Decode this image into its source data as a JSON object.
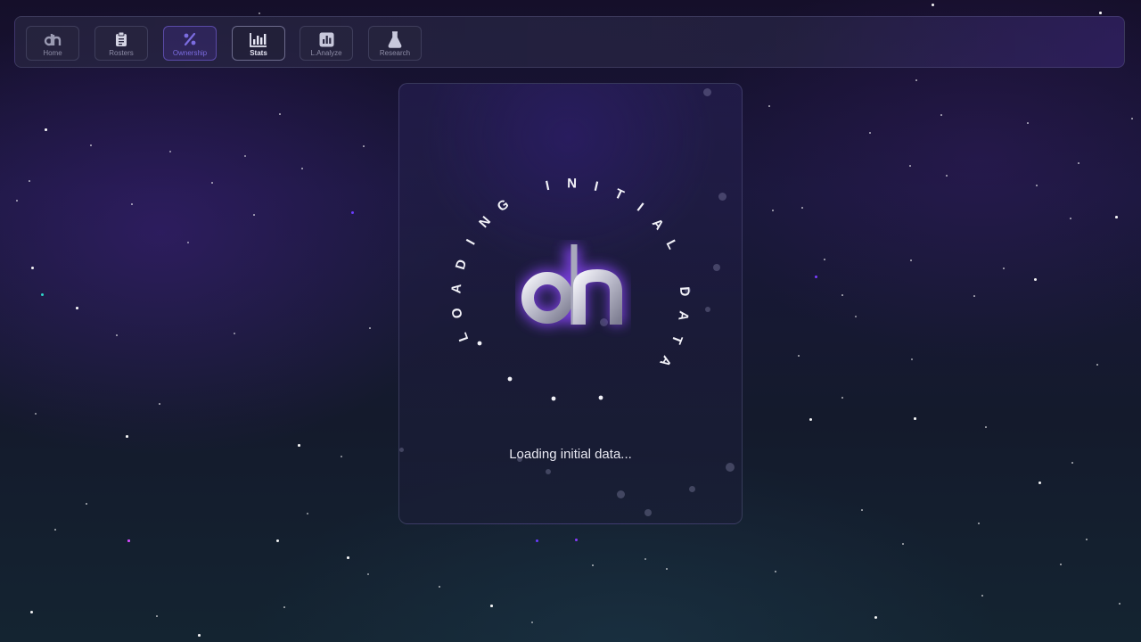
{
  "nav": {
    "items": [
      {
        "label": "Home",
        "icon": "dh-logo-icon"
      },
      {
        "label": "Rosters",
        "icon": "clipboard-icon"
      },
      {
        "label": "Ownership",
        "icon": "percent-icon"
      },
      {
        "label": "Stats",
        "icon": "bar-chart-icon"
      },
      {
        "label": "L.Analyze",
        "icon": "analytics-icon"
      },
      {
        "label": "Research",
        "icon": "flask-icon"
      }
    ],
    "colors": {
      "accent_purple": "#7b6ce0",
      "active_white": "#e6e6f4"
    }
  },
  "loader": {
    "ring_text": "LOADING INITIAL DATA",
    "message": "Loading initial data...",
    "logo": "dh-logo-icon"
  }
}
